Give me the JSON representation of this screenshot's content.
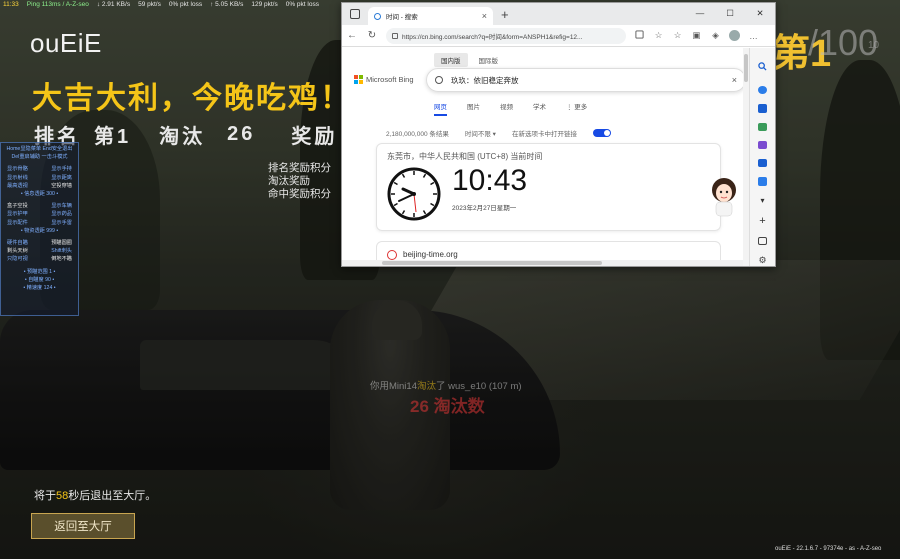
{
  "netbar": {
    "time": "11:33",
    "ping": "Ping 113ms / A-Z-seo",
    "down1": "2.91 KB/s",
    "pkts1": "59 pkt/s",
    "loss1": "0% pkt loss",
    "down2": "5.05 KB/s",
    "pkts2": "129 pkt/s",
    "loss2": "0% pkt loss"
  },
  "hud": {
    "player_name": "ouEiE",
    "headline": "大吉大利，今晚吃鸡！",
    "rank_label": "排名",
    "rank_value": "第1",
    "kills_label": "淘汰",
    "kills_value": "26",
    "reward_label": "奖励",
    "bp_icon": "BP",
    "reward_items": [
      "排名奖励积分",
      "淘汰奖励",
      "命中奖励积分"
    ],
    "big_rank": "第1",
    "big_total": "/100",
    "big_sub": "10",
    "kill_notice_prefix": "你用Mini14",
    "kill_notice_hl": "淘汰",
    "kill_notice_suffix": "了 wus_e10 (107 m)",
    "kill_big": "26 淘汰数",
    "exit_prefix": "将于",
    "exit_seconds": "58",
    "exit_suffix": "秒后退出至大厅。",
    "return_button": "返回至大厅",
    "version": "ouEiE - 22.1.6.7 - 97374e - as - A-Z-seo"
  },
  "cheat_menu": {
    "header": [
      "Home显隐菜单 End安全退出",
      "Del重启辅助  一击斗模式"
    ],
    "rows1": [
      [
        "显示骨骼",
        "显示手持"
      ],
      [
        "显示射线",
        "显示距离"
      ],
      [
        "最高透视",
        "空投穿墙"
      ]
    ],
    "center1": "• 信息透距 300 •",
    "rows2": [
      [
        "盒子空投",
        "显示车辆"
      ],
      [
        "显示护甲",
        "显示药品"
      ],
      [
        "显示配件",
        "显示手雷"
      ]
    ],
    "center2": "• 物资透距 999 •",
    "rows3": [
      [
        "硬件自瞄",
        "预瞄圆圈"
      ],
      [
        "剩头天树",
        "Shift刺头"
      ],
      [
        "只隐可视",
        "倒地不瞄"
      ]
    ],
    "center3": "• 预瞄范围 1 •",
    "center4": "• 自瞄度 90 •",
    "center5": "• 精速度 124 •"
  },
  "browser": {
    "tab_title": "时间 - 搜索",
    "tab_close": "×",
    "new_tab": "+",
    "win_minimize": "—",
    "win_maximize": "☐",
    "win_close": "✕",
    "nav_back": "←",
    "nav_refresh": "↻",
    "url": "https://cn.bing.com/search?q=时间&form=ANSPH1&refig=12...",
    "region_tabs": [
      "国内版",
      "国际版"
    ],
    "logo_text": "Microsoft Bing",
    "search_query": "玖玖：依旧稳定奔放",
    "search_clear": "×",
    "scope_tabs": [
      "网页",
      "图片",
      "视频",
      "学术",
      "⋮ 更多"
    ],
    "results_count": "2,180,000,000 条结果",
    "time_filter": "时间不限 ▾",
    "new_tab_toggle_label": "在新选项卡中打开链接",
    "time_card": {
      "location": "东莞市，中华人民共和国 (UTC+8) 当前时间",
      "digital_time": "10:43",
      "date": "2023年2月27日星期一"
    },
    "second_result_site": "beijing-time.org"
  },
  "colors": {
    "gold": "#f5c518",
    "bing_blue": "#174ae4"
  }
}
